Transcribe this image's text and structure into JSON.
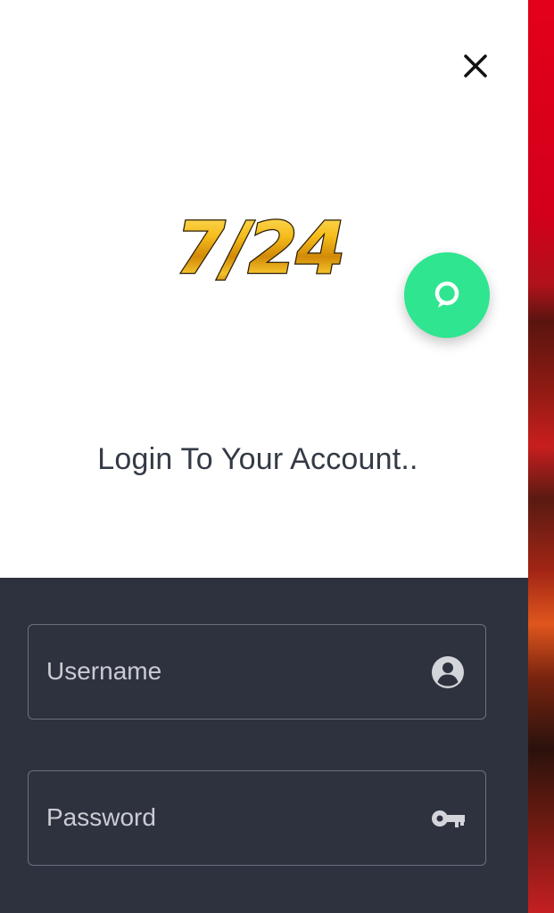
{
  "login": {
    "title": "Login To Your Account..",
    "username_placeholder": "Username",
    "password_placeholder": "Password"
  },
  "brand": {
    "logo_text": "7/24"
  },
  "icons": {
    "close": "close-icon",
    "chat": "chat-bubble-icon",
    "user": "user-circle-icon",
    "key": "key-icon"
  },
  "colors": {
    "panel_top": "#ffffff",
    "panel_bottom": "#2e323f",
    "chat_button": "#2fe58f",
    "logo_gold": "#f2b418",
    "title_text": "#343a46",
    "background_accent": "#e3001a"
  }
}
